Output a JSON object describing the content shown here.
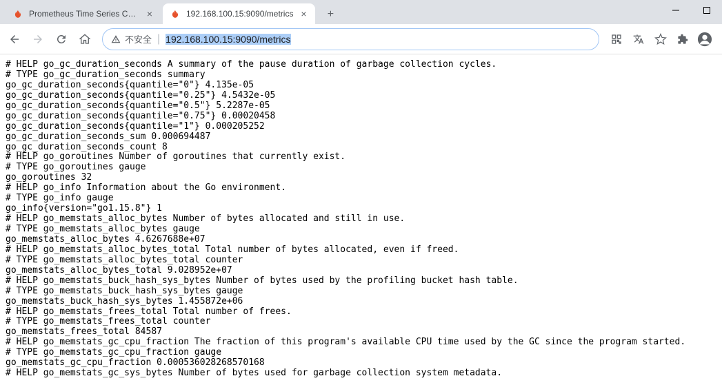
{
  "window": {
    "tabs": [
      {
        "title": "Prometheus Time Series Colle"
      },
      {
        "title": "192.168.100.15:9090/metrics"
      }
    ]
  },
  "toolbar": {
    "insecure_label": "不安全",
    "url_plain": "",
    "url_selected": "192.168.100.15:9090/metrics"
  },
  "metrics_lines": [
    "# HELP go_gc_duration_seconds A summary of the pause duration of garbage collection cycles.",
    "# TYPE go_gc_duration_seconds summary",
    "go_gc_duration_seconds{quantile=\"0\"} 4.135e-05",
    "go_gc_duration_seconds{quantile=\"0.25\"} 4.5432e-05",
    "go_gc_duration_seconds{quantile=\"0.5\"} 5.2287e-05",
    "go_gc_duration_seconds{quantile=\"0.75\"} 0.00020458",
    "go_gc_duration_seconds{quantile=\"1\"} 0.000205252",
    "go_gc_duration_seconds_sum 0.000694487",
    "go_gc_duration_seconds_count 8",
    "# HELP go_goroutines Number of goroutines that currently exist.",
    "# TYPE go_goroutines gauge",
    "go_goroutines 32",
    "# HELP go_info Information about the Go environment.",
    "# TYPE go_info gauge",
    "go_info{version=\"go1.15.8\"} 1",
    "# HELP go_memstats_alloc_bytes Number of bytes allocated and still in use.",
    "# TYPE go_memstats_alloc_bytes gauge",
    "go_memstats_alloc_bytes 4.6267688e+07",
    "# HELP go_memstats_alloc_bytes_total Total number of bytes allocated, even if freed.",
    "# TYPE go_memstats_alloc_bytes_total counter",
    "go_memstats_alloc_bytes_total 9.028952e+07",
    "# HELP go_memstats_buck_hash_sys_bytes Number of bytes used by the profiling bucket hash table.",
    "# TYPE go_memstats_buck_hash_sys_bytes gauge",
    "go_memstats_buck_hash_sys_bytes 1.455872e+06",
    "# HELP go_memstats_frees_total Total number of frees.",
    "# TYPE go_memstats_frees_total counter",
    "go_memstats_frees_total 84587",
    "# HELP go_memstats_gc_cpu_fraction The fraction of this program's available CPU time used by the GC since the program started.",
    "# TYPE go_memstats_gc_cpu_fraction gauge",
    "go_memstats_gc_cpu_fraction 0.000536028268570168",
    "# HELP go_memstats_gc_sys_bytes Number of bytes used for garbage collection system metadata."
  ]
}
